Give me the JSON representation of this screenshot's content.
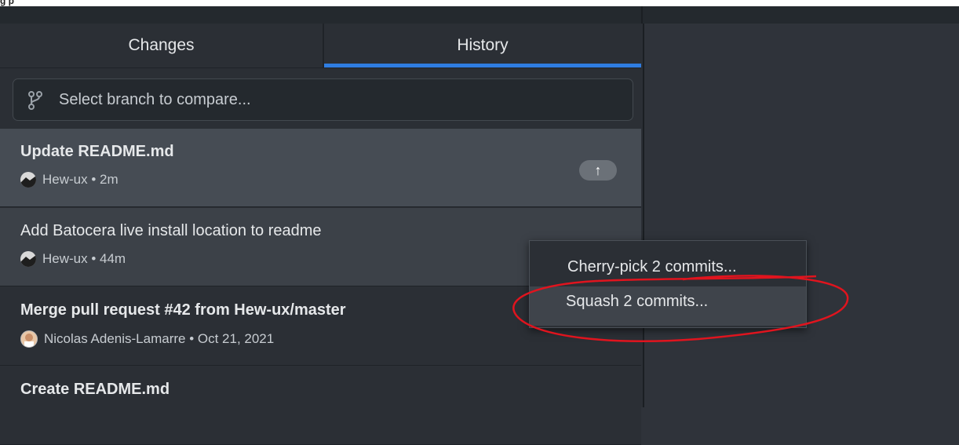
{
  "top_cutoff_text": "g                              p",
  "tabs": [
    {
      "label": "Changes",
      "active": false
    },
    {
      "label": "History",
      "active": true
    }
  ],
  "branch_compare": {
    "placeholder": "Select branch to compare..."
  },
  "commits": [
    {
      "title": "Update README.md",
      "author": "Hew-ux",
      "time": "2m",
      "meta": "Hew-ux • 2m",
      "unpushed": true,
      "selected": true
    },
    {
      "title": "Add Batocera live install location to readme",
      "author": "Hew-ux",
      "time": "44m",
      "meta": "Hew-ux • 44m",
      "selected": true
    },
    {
      "title": "Merge pull request #42 from Hew-ux/master",
      "author": "Nicolas Adenis-Lamarre",
      "time": "Oct 21, 2021",
      "meta": "Nicolas Adenis-Lamarre • Oct 21, 2021"
    },
    {
      "title": "Create README.md",
      "author": "",
      "time": "",
      "meta": ""
    }
  ],
  "push_badge": {
    "icon": "arrow-up-icon",
    "glyph": "↑"
  },
  "context_menu": {
    "items": [
      {
        "label": "Cherry-pick 2 commits..."
      },
      {
        "label": "Squash 2 commits...",
        "highlighted": true
      }
    ]
  },
  "colors": {
    "accent": "#2f7de1",
    "annotation": "#e0141e",
    "selected_row": "#464c54"
  }
}
